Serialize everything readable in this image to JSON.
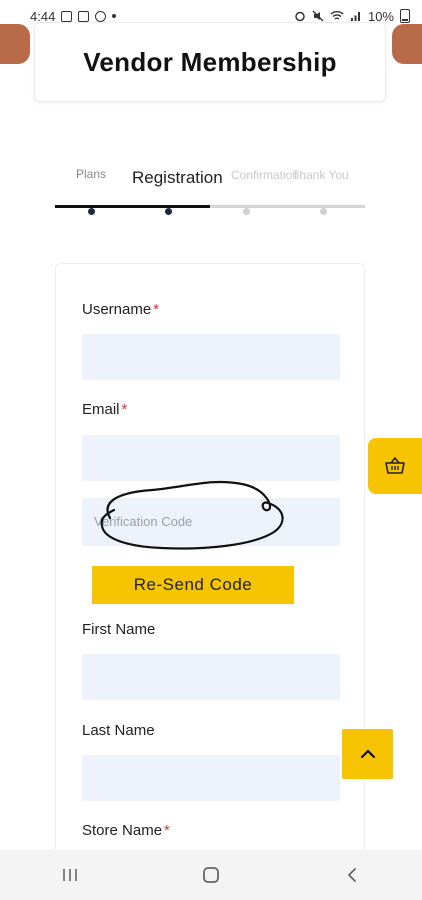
{
  "status_bar": {
    "time": "4:44",
    "battery": "10%"
  },
  "header": {
    "title": "Vendor Membership"
  },
  "stepper": {
    "steps": [
      {
        "label": "Plans"
      },
      {
        "label": "Registration"
      },
      {
        "label": "Confirmation"
      },
      {
        "label": "Thank You"
      }
    ],
    "confirmation_visible": "nfirmation"
  },
  "form": {
    "username_label": "Username",
    "email_label": "Email",
    "required_mark": "*",
    "verification_placeholder": "Verification Code",
    "resend_label": "Re-Send Code",
    "first_name_label": "First Name",
    "last_name_label": "Last Name",
    "store_name_label": "Store Name"
  },
  "icons": {
    "cart": "basket-icon",
    "scroll_top": "chevron-up-icon",
    "nav_recent": "recent-apps-icon",
    "nav_home": "home-icon",
    "nav_back": "back-icon"
  },
  "colors": {
    "accent": "#f6c400",
    "input_bg": "#eef2fb",
    "required": "#e0342f",
    "step_active": "#111111",
    "step_inactive": "#d6d6d6"
  }
}
